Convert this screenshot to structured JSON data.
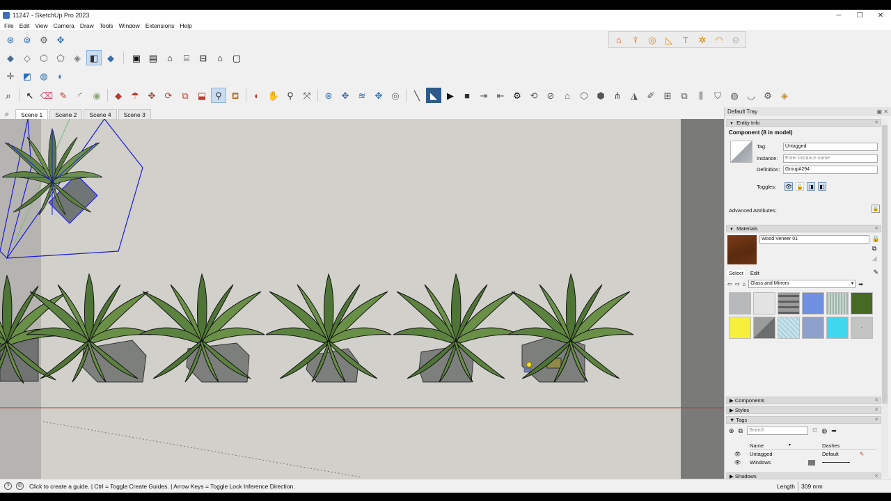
{
  "window": {
    "title": "11247 - SketchUp Pro 2023",
    "minimize": "─",
    "maximize": "❐",
    "close": "✕"
  },
  "menu": [
    "File",
    "Edit",
    "View",
    "Camera",
    "Draw",
    "Tools",
    "Window",
    "Extensions",
    "Help"
  ],
  "scenes": {
    "search_icon": "search-icon",
    "tabs": [
      "Scene 1",
      "Scene 2",
      "Scene 4",
      "Scene 3"
    ],
    "active": "Scene 1"
  },
  "tray": {
    "title": "Default Tray",
    "entity_info": {
      "header": "Entity Info",
      "component_title": "Component (8 in model)",
      "tag_label": "Tag:",
      "tag_value": "Untagged",
      "instance_label": "Instance:",
      "instance_placeholder": "Enter instance name",
      "definition_label": "Definition:",
      "definition_value": "Group#294",
      "toggles_label": "Toggles:",
      "advanced_label": "Advanced Attributes:"
    },
    "materials": {
      "header": "Materials",
      "material_name": "Wood Veneer 01",
      "tab_select": "Select",
      "tab_edit": "Edit",
      "library": "Glass and Mirrors",
      "swatch_colors": [
        "#b7b9bb",
        "#e2e3e2",
        "#7b7b7b",
        "#6f8fe0",
        "#a9c1b7",
        "#466a24",
        "#f7f03a",
        "#8f9190",
        "#c7e3ec",
        "#8ea0cc",
        "#3fd6ef",
        "#b7b7b7"
      ]
    },
    "collapsed": [
      "Components",
      "Styles"
    ],
    "tags": {
      "header": "Tags",
      "search_placeholder": "Search",
      "col_name": "Name",
      "col_dashes": "Dashes",
      "rows": [
        {
          "name": "Untagged",
          "dashes": "Default"
        },
        {
          "name": "Windows",
          "dashes": ""
        }
      ]
    },
    "shadows": "Shadows"
  },
  "status": {
    "message": "Click to create a guide. | Ctrl = Toggle Create Guides. | Arrow Keys = Toggle Lock Inference Direction.",
    "length_label": "Length",
    "length_value": "309 mm"
  }
}
